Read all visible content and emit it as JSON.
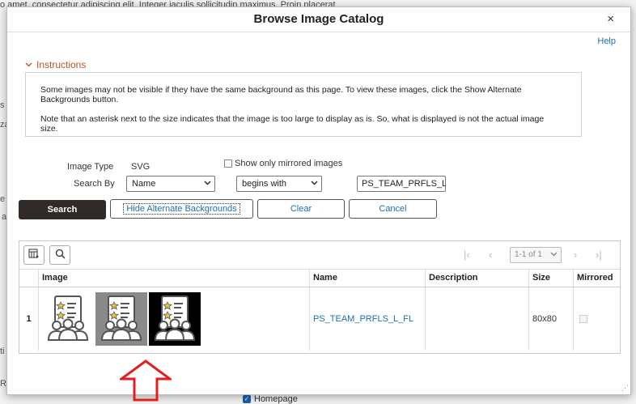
{
  "background": {
    "top_line": "o amet, consectetur adipiscing elit. Integer iaculis sollicitudin maximus. Proin placerat",
    "bottom_checkbox_label": "Homepage"
  },
  "modal": {
    "title": "Browse Image Catalog",
    "close_glyph": "×",
    "help_label": "Help",
    "instructions": {
      "toggle_label": "Instructions",
      "paragraph1": "Some images may not be visible if they have the same background as this page. To view these images, click the Show Alternate Backgrounds button.",
      "paragraph2": "Note that an asterisk next to the size indicates that the image is too large to display as is. So, what is displayed is not the actual image size."
    },
    "form": {
      "image_type_label": "Image Type",
      "image_type_value": "SVG",
      "mirrored_checkbox_label": "Show only mirrored images",
      "search_by_label": "Search By",
      "field_select": "Name",
      "operator_select": "begins with",
      "search_value": "PS_TEAM_PRFLS_L"
    },
    "buttons": {
      "search": "Search",
      "hide_alt": "Hide Alternate Backgrounds",
      "clear": "Clear",
      "cancel": "Cancel"
    },
    "grid": {
      "pager": "1-1 of 1",
      "columns": [
        "Image",
        "Name",
        "Description",
        "Size",
        "Mirrored"
      ],
      "rows": [
        {
          "num": "1",
          "name": "PS_TEAM_PRFLS_L_FL",
          "description": "",
          "size": "80x80",
          "mirrored": false
        }
      ]
    }
  },
  "colors": {
    "accent": "#1a6fb3",
    "primary_button": "#302a28",
    "section_title": "#b5562a",
    "annotation_arrow": "#e02020"
  },
  "icons": [
    "close-icon",
    "chevron-down-icon",
    "personalize-icon",
    "search-icon",
    "first-page-icon",
    "prev-page-icon",
    "next-page-icon",
    "last-page-icon",
    "team-profiles-icon",
    "up-arrow-annotation"
  ]
}
